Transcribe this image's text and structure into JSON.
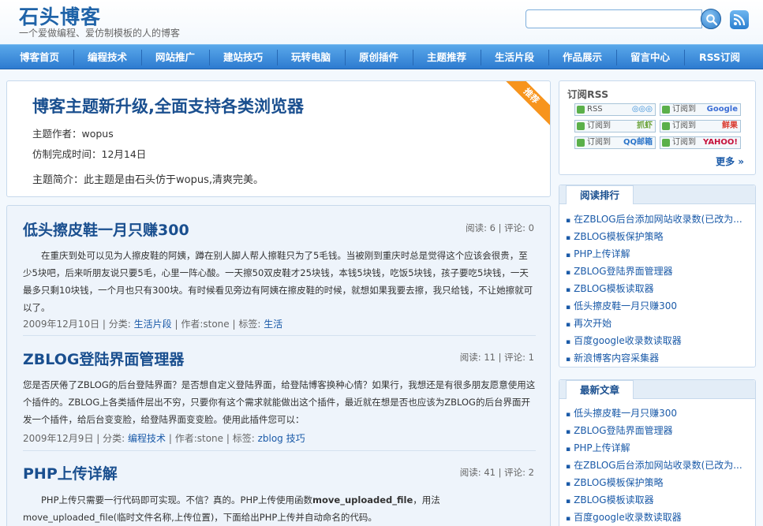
{
  "header": {
    "title": "石头博客",
    "subtitle": "一个爱做编程、爱仿制模板的人的博客",
    "search_placeholder": ""
  },
  "nav": {
    "items": [
      "博客首页",
      "编程技术",
      "网站推广",
      "建站技巧",
      "玩转电脑",
      "原创插件",
      "主题推荐",
      "生活片段",
      "作品展示",
      "留言中心",
      "RSS订阅"
    ]
  },
  "featured": {
    "title": "博客主题新升级,全面支持各类浏览器",
    "author": "主题作者：wopus",
    "finished": "仿制完成时间：12月14日",
    "intro": "主题简介：此主题是由石头仿于wopus,清爽完美。",
    "ribbon": "推荐"
  },
  "posts": [
    {
      "title": "低头擦皮鞋一月只赚300",
      "stats": "阅读: 6 | 评论: 0",
      "body": "　　在重庆到处可以见为人擦皮鞋的阿姨，蹲在别人脚人帮人擦鞋只为了5毛钱。当被刚到重庆时总是觉得这个应该会很贵，至少5块吧，后来听朋友说只要5毛，心里一阵心酸。一天擦50双皮鞋才25块钱，本钱5块钱，吃饭5块钱，孩子要吃5块钱，一天最多只剩10块钱，一个月也只有300块。有时候看见旁边有阿姨在擦皮鞋的时候，就想如果我要去擦，我只给钱，不让她擦就可以了。",
      "date": "2009年12月10日 | 分类:",
      "category": "生活片段",
      "author": "| 作者:stone | 标签:",
      "tags": [
        "生活"
      ]
    },
    {
      "title": "ZBLOG登陆界面管理器",
      "stats": "阅读: 11 | 评论: 1",
      "body": "您是否厌倦了ZBLOG的后台登陆界面？是否想自定义登陆界面，给登陆博客换种心情？如果行，我想还是有很多朋友愿意使用这个插件的。ZBLOG上各类插件层出不穷，只要你有这个需求就能做出这个插件，最近就在想是否也应该为ZBLOG的后台界面开发一个插件，给后台变变脸，给登陆界面变变脸。使用此插件您可以：",
      "date": "2009年12月9日 | 分类:",
      "category": "编程技术",
      "author": "| 作者:stone | 标签:",
      "tags": [
        "zblog",
        "技巧"
      ]
    },
    {
      "title": "PHP上传详解",
      "stats": "阅读: 41 | 评论: 2",
      "body_pre": "　　PHP上传只需要一行代码即可实现。不信？真的。PHP上传使用函数",
      "body_strong": "move_uploaded_file",
      "body_post": "，用法move_uploaded_file(临时文件名称,上传位置)，下面给出PHP上传并自动命名的代码。"
    }
  ],
  "sidebar": {
    "rss_box": {
      "title": "订阅RSS",
      "badges": [
        {
          "label": "RSS",
          "brand": "◎◎◎",
          "color": "#3a8fd8"
        },
        {
          "label": "订阅到",
          "brand": "Google",
          "color": "#3b6ed6"
        },
        {
          "label": "订阅到",
          "brand": "抓虾",
          "color": "#6aa23a"
        },
        {
          "label": "订阅到",
          "brand": "鲜果",
          "color": "#d9372b"
        },
        {
          "label": "订阅到",
          "brand": "QQ邮箱",
          "color": "#2a74c9"
        },
        {
          "label": "订阅到",
          "brand": "YAHOO!",
          "color": "#c6113b"
        }
      ],
      "more": "更多 »"
    },
    "ranking": {
      "tab": "阅读排行",
      "items": [
        "在ZBLOG后台添加网站收录数(已改为...",
        "ZBLOG模板保护策略",
        "PHP上传详解",
        "ZBLOG登陆界面管理器",
        "ZBLOG模板读取器",
        "低头擦皮鞋一月只赚300",
        "再次开始",
        "百度google收录数读取器",
        "新浪博客内容采集器"
      ]
    },
    "latest": {
      "tab": "最新文章",
      "items": [
        "低头擦皮鞋一月只赚300",
        "ZBLOG登陆界面管理器",
        "PHP上传详解",
        "在ZBLOG后台添加网站收录数(已改为...",
        "ZBLOG模板保护策略",
        "ZBLOG模板读取器",
        "百度google收录数读取器"
      ]
    }
  }
}
